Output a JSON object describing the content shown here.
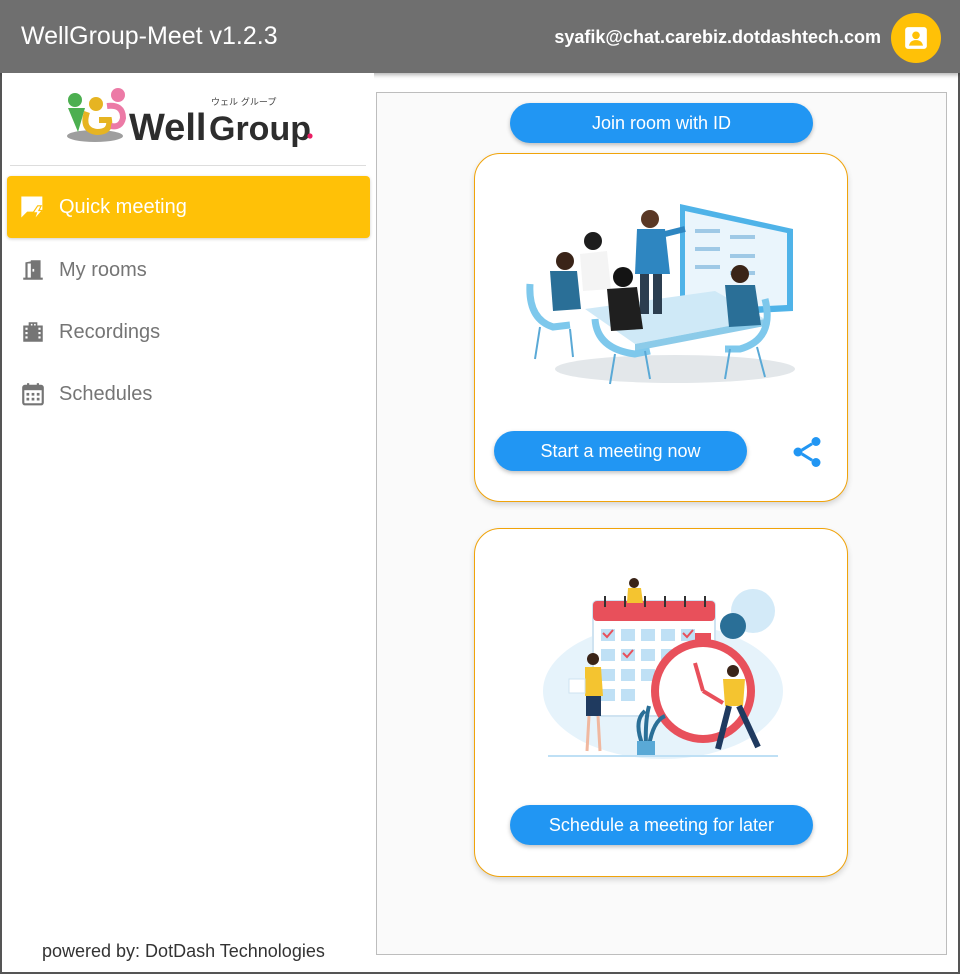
{
  "app": {
    "title": "WellGroup-Meet v1.2.3",
    "user_email": "syafik@chat.carebiz.dotdashtech.com"
  },
  "logo": {
    "text_well": "Well",
    "text_group": "Group",
    "text_kana": "ウェル グループ"
  },
  "sidebar": {
    "items": [
      {
        "label": "Quick meeting",
        "icon": "quick-meeting-icon",
        "active": true
      },
      {
        "label": "My rooms",
        "icon": "door-icon",
        "active": false
      },
      {
        "label": "Recordings",
        "icon": "film-icon",
        "active": false
      },
      {
        "label": "Schedules",
        "icon": "calendar-icon",
        "active": false
      }
    ],
    "footer": "powered by: DotDash Technologies"
  },
  "main": {
    "join_label": "Join room with ID",
    "start_label": "Start a meeting now",
    "schedule_label": "Schedule a meeting for later"
  },
  "colors": {
    "appbar": "#6f6f6f",
    "accent": "#ffc107",
    "primary": "#2196f3",
    "card_border": "#f0a30a"
  }
}
